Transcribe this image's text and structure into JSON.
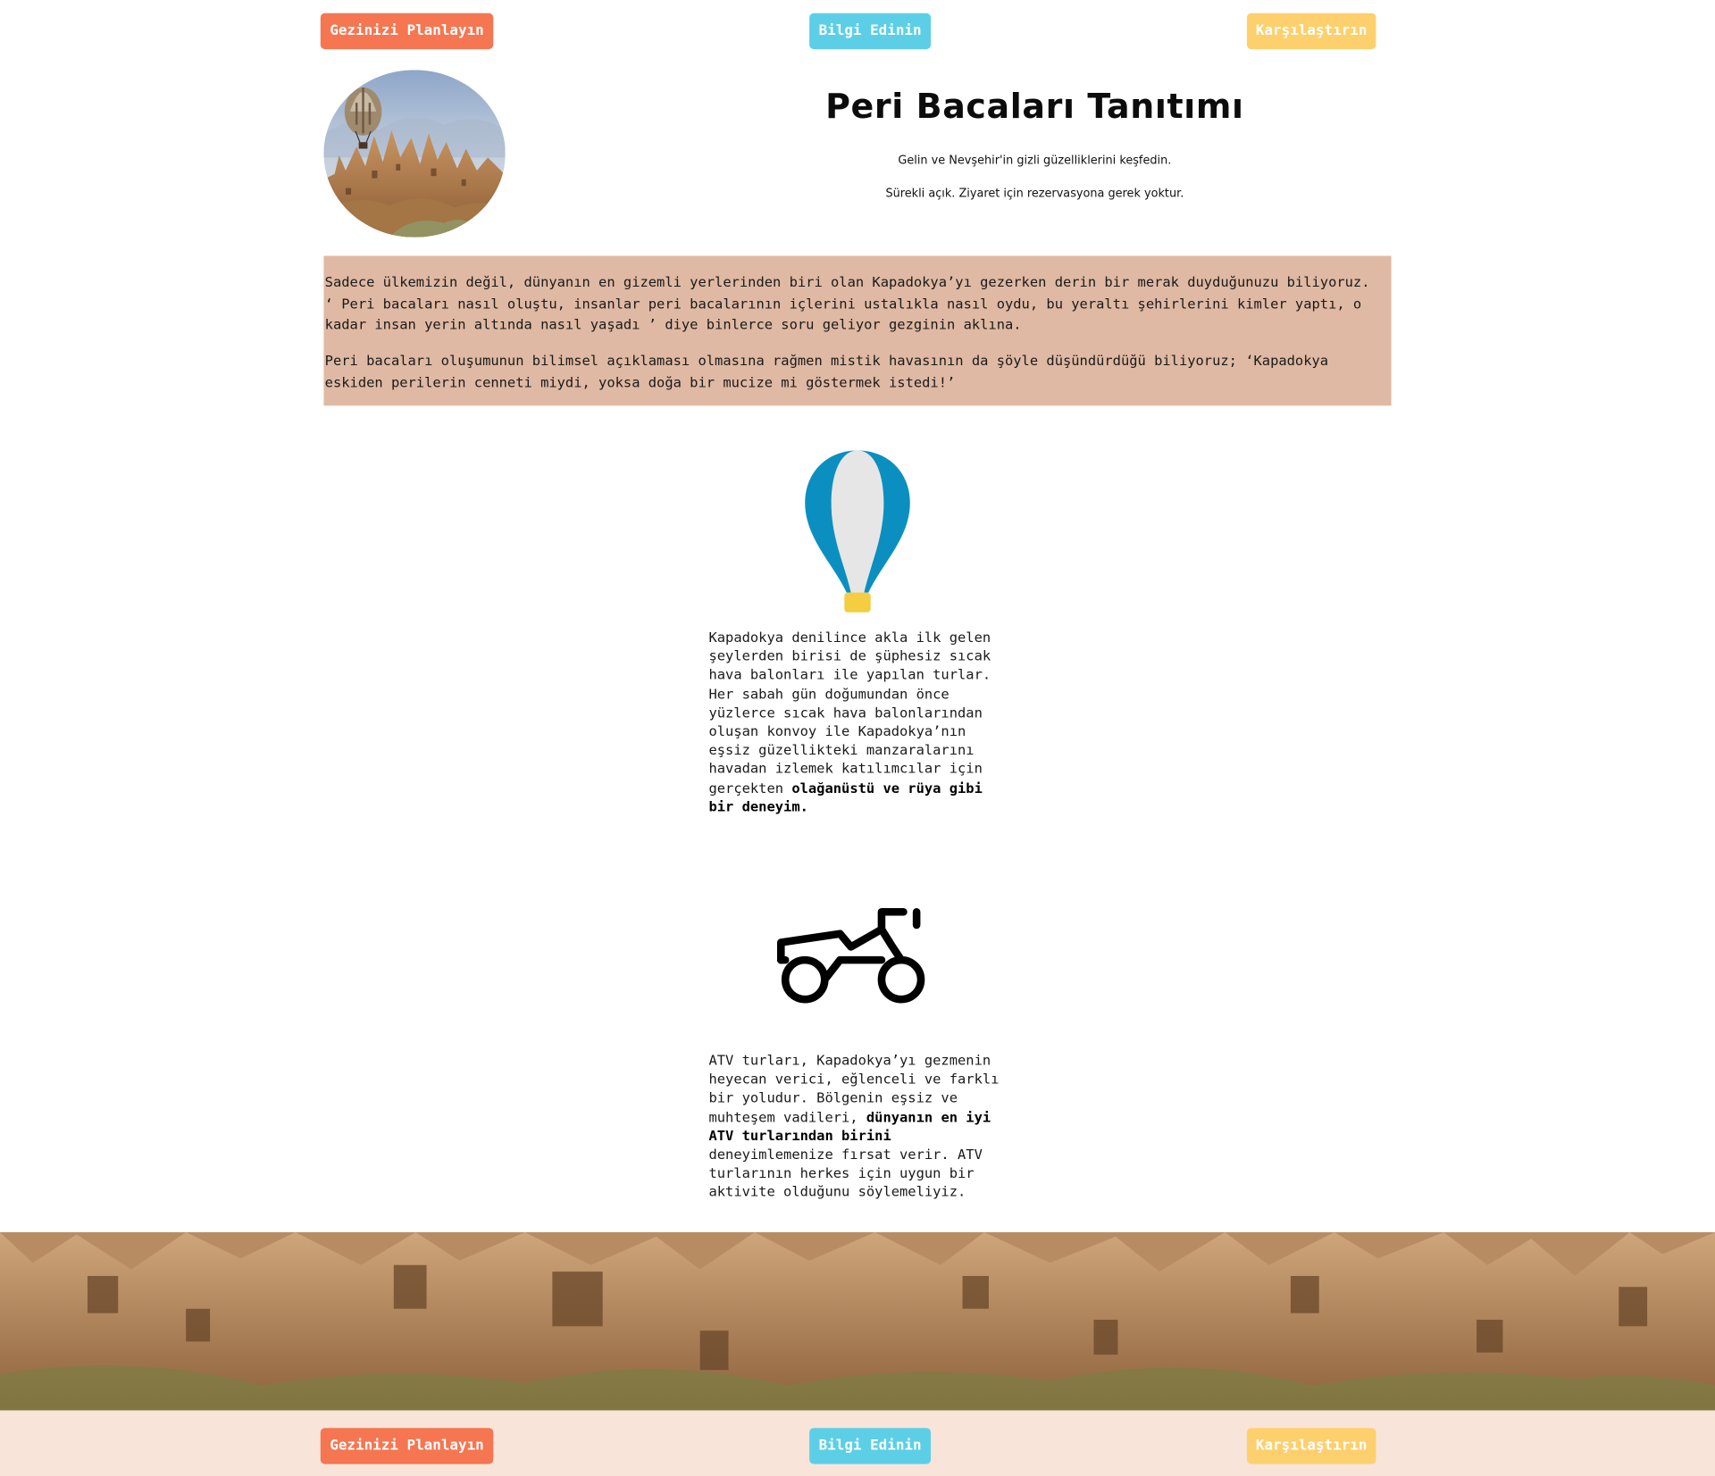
{
  "nav": {
    "plan_label": "Gezinizi Planlayın",
    "info_label": "Bilgi Edinin",
    "compare_label": "Karşılaştırın"
  },
  "hero": {
    "image_icon": "cappadocia-balloon-photo",
    "title": "Peri Bacaları Tanıtımı",
    "subtitle": "Gelin ve Nevşehir'in gizli güzelliklerini keşfedin.",
    "note": "Sürekli açık. Ziyaret için rezervasyona gerek yoktur."
  },
  "intro": {
    "paragraph1": "Sadece ülkemizin değil, dünyanın en gizemli yerlerinden biri olan Kapadokya’yı gezerken derin bir merak duyduğunuzu biliyoruz. ‘ Peri bacaları nasıl oluştu, insanlar peri bacalarının içlerini ustalıkla nasıl oydu, bu yeraltı şehirlerini kimler yaptı, o kadar insan yerin altında nasıl yaşadı ’ diye binlerce soru geliyor gezginin aklına.",
    "paragraph2": "Peri bacaları oluşumunun bilimsel açıklaması olmasına rağmen mistik havasının da şöyle düşündürdüğü biliyoruz; ‘Kapadokya eskiden perilerin cenneti miydi, yoksa doğa bir mucize mi göstermek istedi!’"
  },
  "features": [
    {
      "icon": "hot-air-balloon-icon",
      "text_before": "Kapadokya denilince akla ilk gelen şeylerden birisi de şüphesiz sıcak hava balonları ile yapılan turlar. Her sabah gün doğumundan önce yüzlerce sıcak hava balonlarından oluşan konvoy ile Kapadokya’nın eşsiz güzellikteki manzaralarını havadan izlemek katılımcılar için gerçekten ",
      "text_bold": "olağanüstü ve rüya gibi bir deneyim.",
      "text_after": ""
    },
    {
      "icon": "atv-icon",
      "text_before": "ATV turları, Kapadokya’yı gezmenin heyecan verici, eğlenceli ve farklı bir yoludur. Bölgenin eşsiz ve muhteşem vadileri, ",
      "text_bold": "dünyanın en iyi ATV turlarından birini",
      "text_after": " deneyimlemenize fırsat verir. ATV turlarının herkes için uygun bir aktivite olduğunu söylemeliyiz."
    }
  ],
  "panorama": {
    "image_icon": "fairy-chimneys-panorama"
  },
  "footer": {
    "plan_label": "Gezinizi Planlayın",
    "info_label": "Bilgi Edinin",
    "compare_label": "Karşılaştırın"
  },
  "colors": {
    "plan": "#f57651",
    "info": "#5ccfe6",
    "compare": "#fdd06d",
    "intro_bg": "#dfb9a3",
    "footer_bg": "#f8e4d9",
    "balloon_blue": "#0b8fc0"
  }
}
